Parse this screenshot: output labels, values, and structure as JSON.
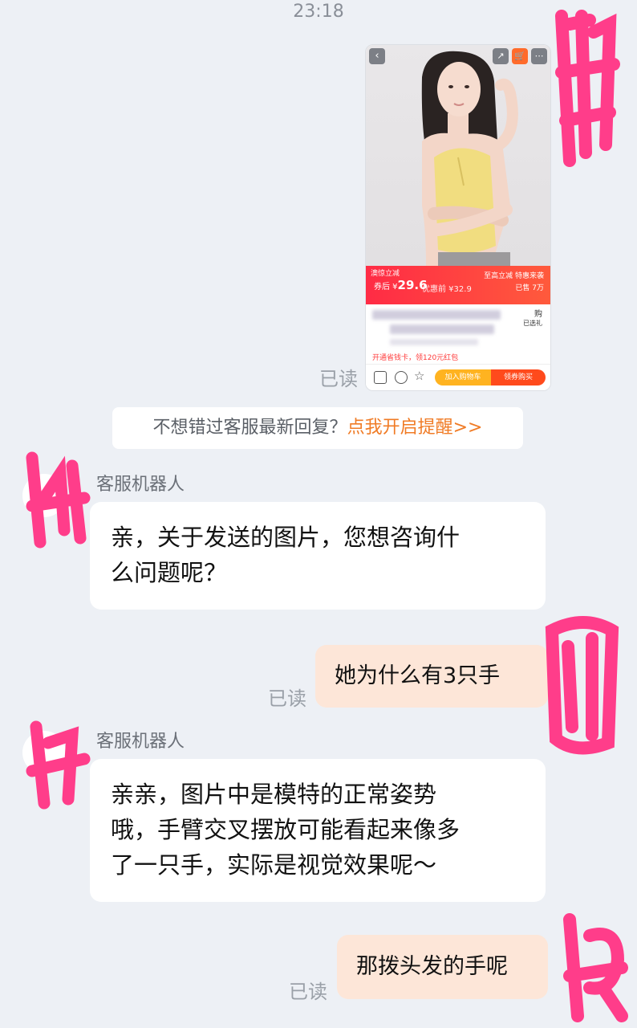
{
  "time": "23:18",
  "product_card": {
    "price_tag": "澳惊立减",
    "price_main_prefix": "券后 ¥",
    "price_main": "29.6",
    "price_sub": "优惠前 ¥32.9",
    "right_tag": "至高立减 特惠来袭",
    "right_sold": "已售 7万",
    "pay_text": "开通省钱卡，领120元红包",
    "btn_left": "加入购物车",
    "btn_right": "领券购买",
    "side_label": "购",
    "side_label2": "已选礼"
  },
  "read_label": "已读",
  "tip": {
    "prefix": "不想错过客服最新回复？",
    "link": "点我开启提醒>>"
  },
  "messages": [
    {
      "sender": "客服机器人",
      "text_lines": [
        "亲，关于发送的图片，您想咨询什",
        "么问题呢？"
      ]
    },
    {
      "text": "她为什么有3只手"
    },
    {
      "sender": "客服机器人",
      "text_lines": [
        "亲亲，图片中是模特的正常姿势",
        "哦，手臂交叉摆放可能看起来像多",
        "了一只手，实际是视觉效果呢～"
      ]
    },
    {
      "text": "那拨头发的手呢"
    }
  ],
  "colors": {
    "background": "#edf0f5",
    "outgoing_bubble": "#fde6d8",
    "link": "#f07b25",
    "scribble": "#ff3d8a"
  }
}
